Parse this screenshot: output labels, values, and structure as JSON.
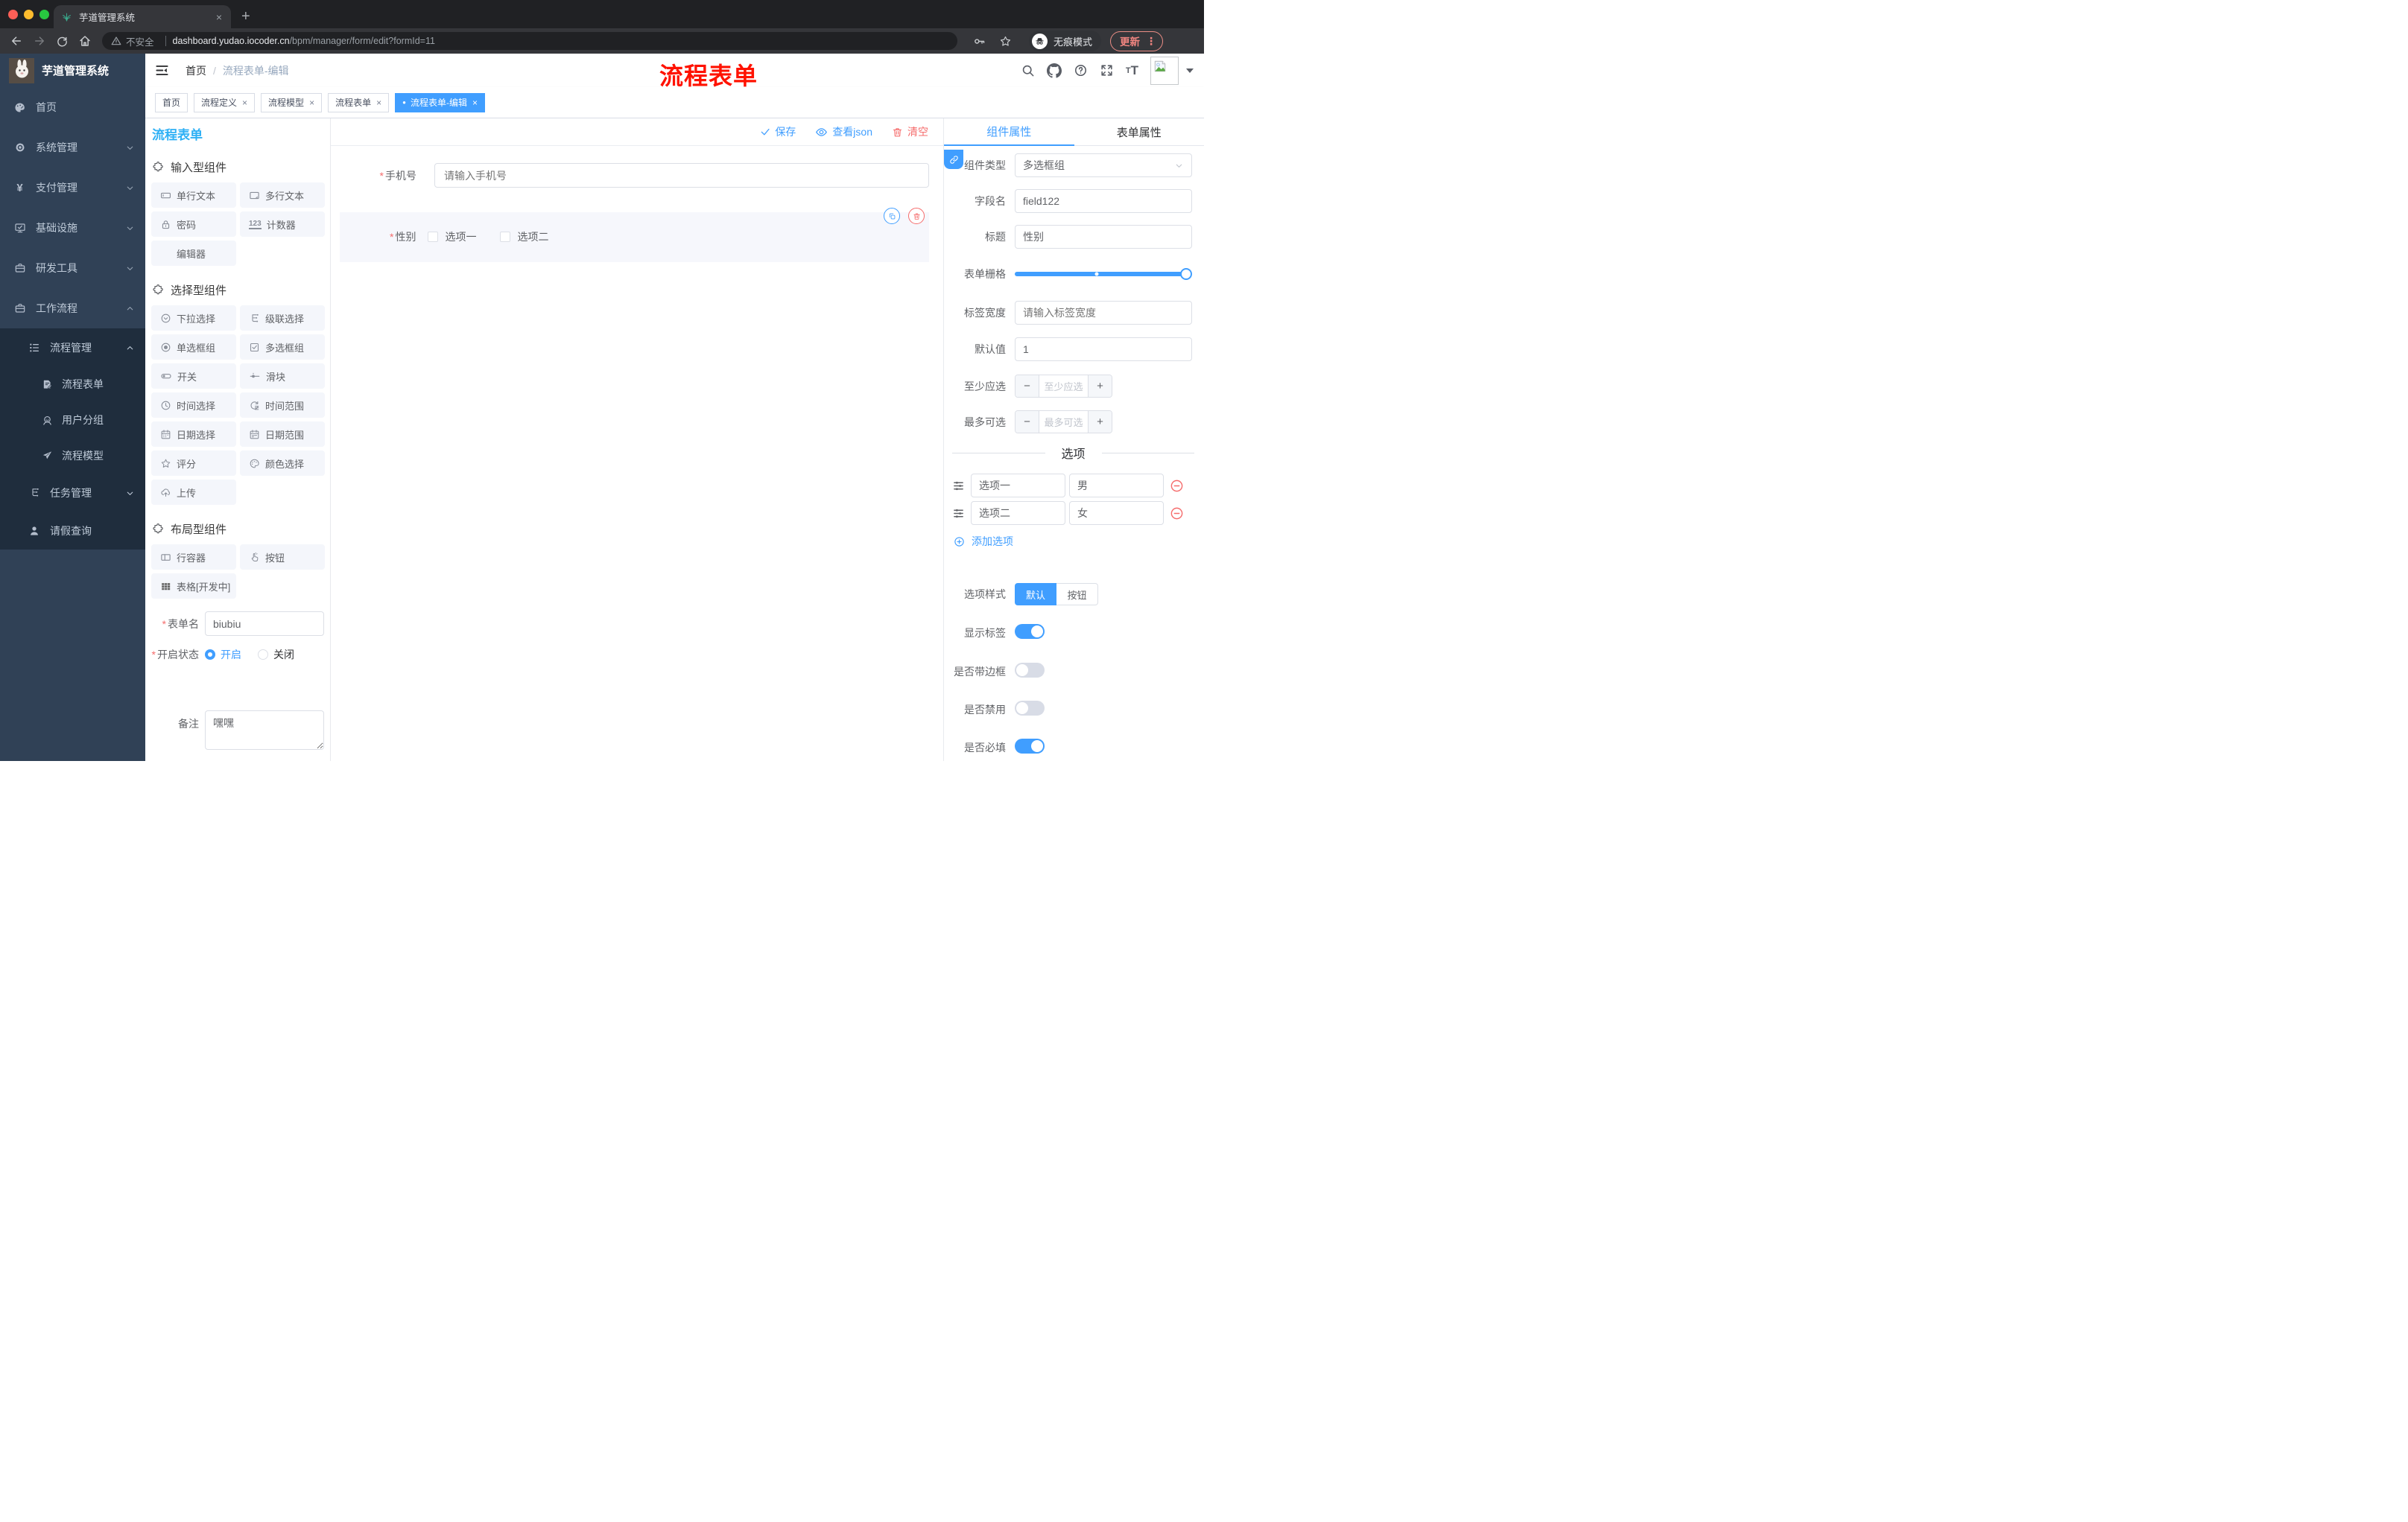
{
  "colors": {
    "accent": "#409eff",
    "panel-title": "#2eb0f5",
    "danger": "#f56c6c",
    "annotation": "#ff1200",
    "sidebar-bg": "#304156",
    "submenu-bg": "#1f2d3d"
  },
  "glyphs": {
    "close": "×",
    "new_tab": "+",
    "kebab": "⋮",
    "yen": "¥",
    "counter": "123",
    "question": "?",
    "dot": "●",
    "asterisk": "*",
    "minus": "−",
    "plus": "+",
    "slash": "/",
    "font_small": "T",
    "font_big": "T"
  },
  "browser": {
    "tab_title": "芋道管理系统",
    "security": "不安全",
    "url_host": "dashboard.yudao.iocoder.cn",
    "url_path": "/bpm/manager/form/edit?formId=11",
    "incognito": "无痕模式",
    "update": "更新"
  },
  "sidebar": {
    "logo_title": "芋道管理系统",
    "items": [
      {
        "label": "首页",
        "icon": "dashboard-icon"
      },
      {
        "label": "系统管理",
        "icon": "gear-icon"
      },
      {
        "label": "支付管理",
        "icon": "yen-icon"
      },
      {
        "label": "基础设施",
        "icon": "monitor-icon"
      },
      {
        "label": "研发工具",
        "icon": "toolbox-icon"
      },
      {
        "label": "工作流程",
        "icon": "briefcase-icon"
      }
    ],
    "sub": {
      "manage": "流程管理",
      "form": "流程表单",
      "group": "用户分组",
      "model": "流程模型",
      "task": "任务管理",
      "leave": "请假查询"
    }
  },
  "header": {
    "breadcrumb_home": "首页",
    "breadcrumb_current": "流程表单-编辑",
    "annotation": "流程表单"
  },
  "tags": {
    "items": [
      {
        "label": "首页"
      },
      {
        "label": "流程定义"
      },
      {
        "label": "流程模型"
      },
      {
        "label": "流程表单"
      },
      {
        "label": "流程表单-编辑"
      }
    ]
  },
  "designer": {
    "left": {
      "title": "流程表单",
      "sections": [
        {
          "title": "输入型组件",
          "items": [
            {
              "label": "单行文本",
              "icon": "input-icon"
            },
            {
              "label": "多行文本",
              "icon": "textarea-icon"
            },
            {
              "label": "密码",
              "icon": "lock-icon"
            },
            {
              "label": "计数器",
              "icon": "counter-icon"
            },
            {
              "label": "编辑器",
              "icon": "none"
            }
          ]
        },
        {
          "title": "选择型组件",
          "items": [
            {
              "label": "下拉选择",
              "icon": "select-icon"
            },
            {
              "label": "级联选择",
              "icon": "cascade-icon"
            },
            {
              "label": "单选框组",
              "icon": "radio-icon"
            },
            {
              "label": "多选框组",
              "icon": "checkbox-icon"
            },
            {
              "label": "开关",
              "icon": "switch-icon"
            },
            {
              "label": "滑块",
              "icon": "slider-icon"
            },
            {
              "label": "时间选择",
              "icon": "clock-icon"
            },
            {
              "label": "时间范围",
              "icon": "time-range-icon"
            },
            {
              "label": "日期选择",
              "icon": "calendar-icon"
            },
            {
              "label": "日期范围",
              "icon": "date-range-icon"
            },
            {
              "label": "评分",
              "icon": "star-icon"
            },
            {
              "label": "颜色选择",
              "icon": "palette-icon"
            },
            {
              "label": "上传",
              "icon": "upload-icon"
            }
          ]
        },
        {
          "title": "布局型组件",
          "items": [
            {
              "label": "行容器",
              "icon": "row-container-icon"
            },
            {
              "label": "按钮",
              "icon": "click-hand-icon"
            },
            {
              "label": "表格[开发中]",
              "icon": "table-icon"
            }
          ]
        }
      ],
      "form": {
        "name_label": "表单名",
        "name_value": "biubiu",
        "status_label": "开启状态",
        "status_on": "开启",
        "status_off": "关闭",
        "remark_label": "备注",
        "remark_value": "嘿嘿"
      }
    },
    "canvas": {
      "save": "保存",
      "view_json": "查看json",
      "clear": "清空",
      "phone_label": "手机号",
      "phone_placeholder": "请输入手机号",
      "gender_label": "性别",
      "gender_opt1": "选项一",
      "gender_opt2": "选项二"
    },
    "props": {
      "tab_component": "组件属性",
      "tab_form": "表单属性",
      "comp_type_label": "组件类型",
      "comp_type_value": "多选框组",
      "field_label": "字段名",
      "field_value": "field122",
      "title_label": "标题",
      "title_value": "性别",
      "grid_label": "表单栅格",
      "grid_slider": {
        "value_percent": 100,
        "fill_style": "width:100%",
        "stop_style": "left:48%",
        "handle_style": "left:100%"
      },
      "label_width_label": "标签宽度",
      "label_width_placeholder": "请输入标签宽度",
      "default_label": "默认值",
      "default_value": "1",
      "min_label": "至少应选",
      "min_placeholder": "至少应选",
      "max_label": "最多可选",
      "max_placeholder": "最多可选",
      "options_divider": "选项",
      "options": [
        {
          "label": "选项一",
          "value": "男"
        },
        {
          "label": "选项二",
          "value": "女"
        }
      ],
      "add_option": "添加选项",
      "style_label": "选项样式",
      "style_default": "默认",
      "style_button": "按钮",
      "show_label": "显示标签",
      "border_label": "是否带边框",
      "disabled_label": "是否禁用",
      "required_label": "是否必填"
    }
  }
}
